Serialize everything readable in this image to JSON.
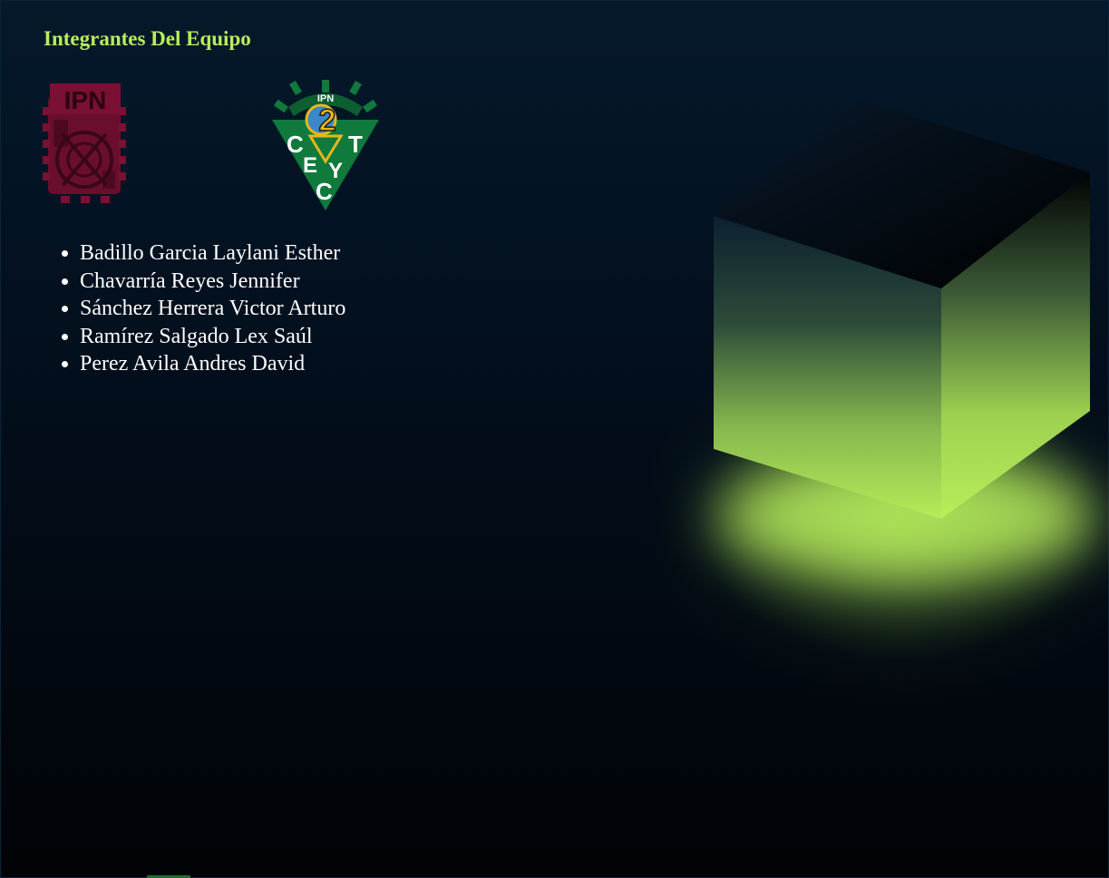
{
  "page": {
    "title": "Integrantes Del Equipo"
  },
  "logos": {
    "ipn": {
      "text": "IPN",
      "icon": "ipn-logo"
    },
    "cecyt": {
      "text": "IPN",
      "number": "2",
      "letters": [
        "C",
        "E",
        "C",
        "Y",
        "T"
      ],
      "icon": "cecyt-logo"
    }
  },
  "members": [
    "Badillo Garcia Laylani Esther",
    "Chavarría Reyes Jennifer",
    "Sánchez Herrera Victor Arturo",
    "Ramírez Salgado Lex Saúl",
    "Perez Avila Andres David"
  ],
  "colors": {
    "accent": "#b7ee5c",
    "background_top": "#05192b",
    "background_bottom": "#010306",
    "ipn_logo": "#7a1034",
    "cecyt_green": "#0f7a3c",
    "cecyt_gold": "#e7b71c"
  }
}
